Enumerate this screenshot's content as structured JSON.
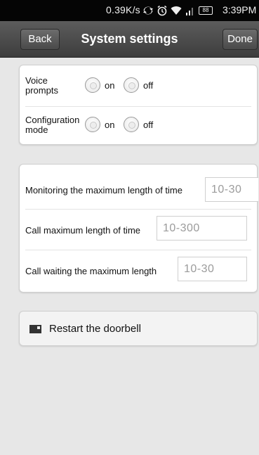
{
  "status_bar": {
    "net_speed": "0.39K/s",
    "battery": "88",
    "time": "3:39PM",
    "icons": [
      "sync-icon",
      "alarm-icon",
      "wifi-icon",
      "signal-icon",
      "battery-icon"
    ]
  },
  "nav": {
    "back_label": "Back",
    "title": "System settings",
    "done_label": "Done"
  },
  "toggles": {
    "voice_prompts": {
      "label": "Voice prompts",
      "on_label": "on",
      "off_label": "off"
    },
    "configuration_mode": {
      "label": "Configuration mode",
      "on_label": "on",
      "off_label": "off"
    }
  },
  "limits": {
    "monitoring": {
      "label": "Monitoring the maximum length of time",
      "placeholder": "10-30"
    },
    "call": {
      "label": "Call maximum length of time",
      "placeholder": "10-300"
    },
    "call_waiting": {
      "label": "Call waiting the maximum length",
      "placeholder": "10-30"
    }
  },
  "restart": {
    "label": "Restart the doorbell"
  }
}
